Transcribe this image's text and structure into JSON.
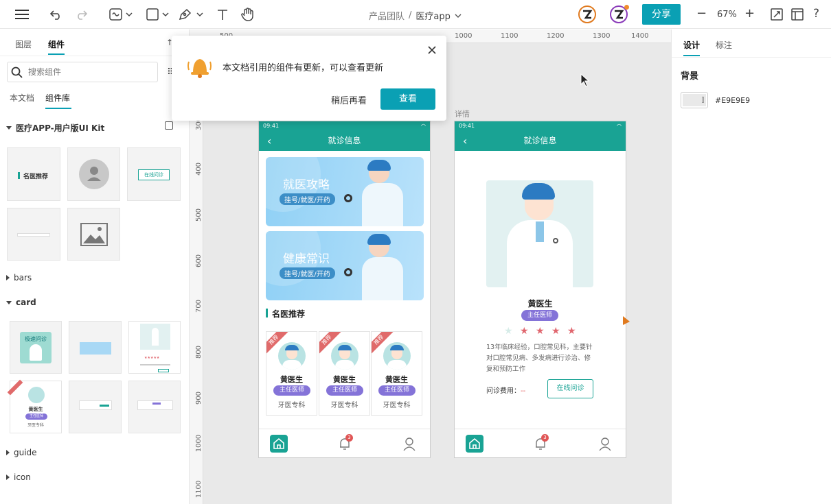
{
  "header": {
    "breadcrumb_team": "产品团队",
    "breadcrumb_sep": "/",
    "project": "医疗app",
    "share_label": "分享",
    "zoom": "67%",
    "zoom_minus": "−",
    "zoom_plus": "+",
    "help": "?"
  },
  "left_panel": {
    "tabs": [
      "图层",
      "组件"
    ],
    "search_placeholder": "搜索组件",
    "subtabs": [
      "本文档",
      "组件库"
    ],
    "kit_title": "医疗APP-用户版UI Kit",
    "thumb_labels": [
      "名医推荐",
      "在线问诊"
    ],
    "sections": [
      "bars",
      "card",
      "guide",
      "icon"
    ],
    "card_thumb_texts": [
      "极速问诊",
      "推荐",
      "黄医生",
      "主任医师",
      "牙医专科"
    ]
  },
  "notification": {
    "message": "本文档引用的组件有更新，可以查看更新",
    "later_label": "稍后再看",
    "view_label": "查看"
  },
  "canvas": {
    "ruler_top": [
      "500",
      "600",
      "700",
      "800",
      "900",
      "1000",
      "1100",
      "1200",
      "1300",
      "1400"
    ],
    "ruler_left": [
      "300",
      "400",
      "500",
      "600",
      "700",
      "800",
      "900",
      "1000",
      "1100"
    ],
    "frame2_label": "详情"
  },
  "phone1": {
    "time": "09:41",
    "title": "就诊信息",
    "banner1_title": "就医攻略",
    "banner1_sub": "挂号/就医/开药",
    "banner2_title": "健康常识",
    "banner2_sub": "挂号/就医/开药",
    "section_title": "名医推荐",
    "cards": [
      {
        "ribbon": "推荐",
        "name": "黄医生",
        "tag": "主任医师",
        "dept": "牙医专科"
      },
      {
        "ribbon": "推荐",
        "name": "黄医生",
        "tag": "主任医师",
        "dept": "牙医专科"
      },
      {
        "ribbon": "推荐",
        "name": "黄医生",
        "tag": "主任医师",
        "dept": "牙医专科"
      }
    ],
    "badge": "3"
  },
  "phone2": {
    "time": "09:41",
    "title": "就诊信息",
    "doctor_name": "黄医生",
    "doctor_tag": "主任医师",
    "rating": 4,
    "stars": [
      "★",
      "★",
      "★",
      "★",
      "★"
    ],
    "description": "13年临床经验，口腔常见科，主要针对口腔常见病、多发病进行诊治、修复和预防工作",
    "fee_label": "问诊费用：",
    "fee_value": "--",
    "consult_label": "在线问诊",
    "badge": "3"
  },
  "right_panel": {
    "tabs": [
      "设计",
      "标注"
    ],
    "section_title": "背景",
    "bg_hex": "#E9E9E9"
  },
  "colors": {
    "accent": "#0aa0b4",
    "phone_green": "#19a394",
    "tag_purple": "#8473d8",
    "star_red": "#e0666e",
    "canvas_bg": "#e9e9e9"
  }
}
